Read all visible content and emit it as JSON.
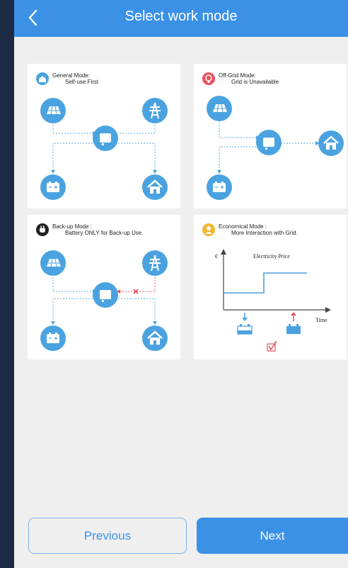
{
  "header": {
    "title": "Select work mode"
  },
  "modes": [
    {
      "line1": "General Mode:",
      "line2": "Self-use First"
    },
    {
      "line1": "Off-Grid Mode:",
      "line2": "Grid is Unavailable"
    },
    {
      "line1": "Back-up Mode :",
      "line2": "Battery ONLY for Back-up Use."
    },
    {
      "line1": "Economical Mode :",
      "line2": "More Interaction with Grid."
    }
  ],
  "economical_chart": {
    "y_unit": "€",
    "title": "Electricity Price",
    "x_label": "Time"
  },
  "footer": {
    "previous_label": "Previous",
    "next_label": "Next"
  },
  "colors": {
    "accent": "#3b91e6",
    "mode_icon_general": "#4aa3e0",
    "mode_icon_offgrid": "#e8525f",
    "mode_icon_backup": "#222222",
    "mode_icon_economical": "#f5b630",
    "battery_down_arrow": "#4aa3e0",
    "battery_up_arrow": "#e8525f"
  }
}
